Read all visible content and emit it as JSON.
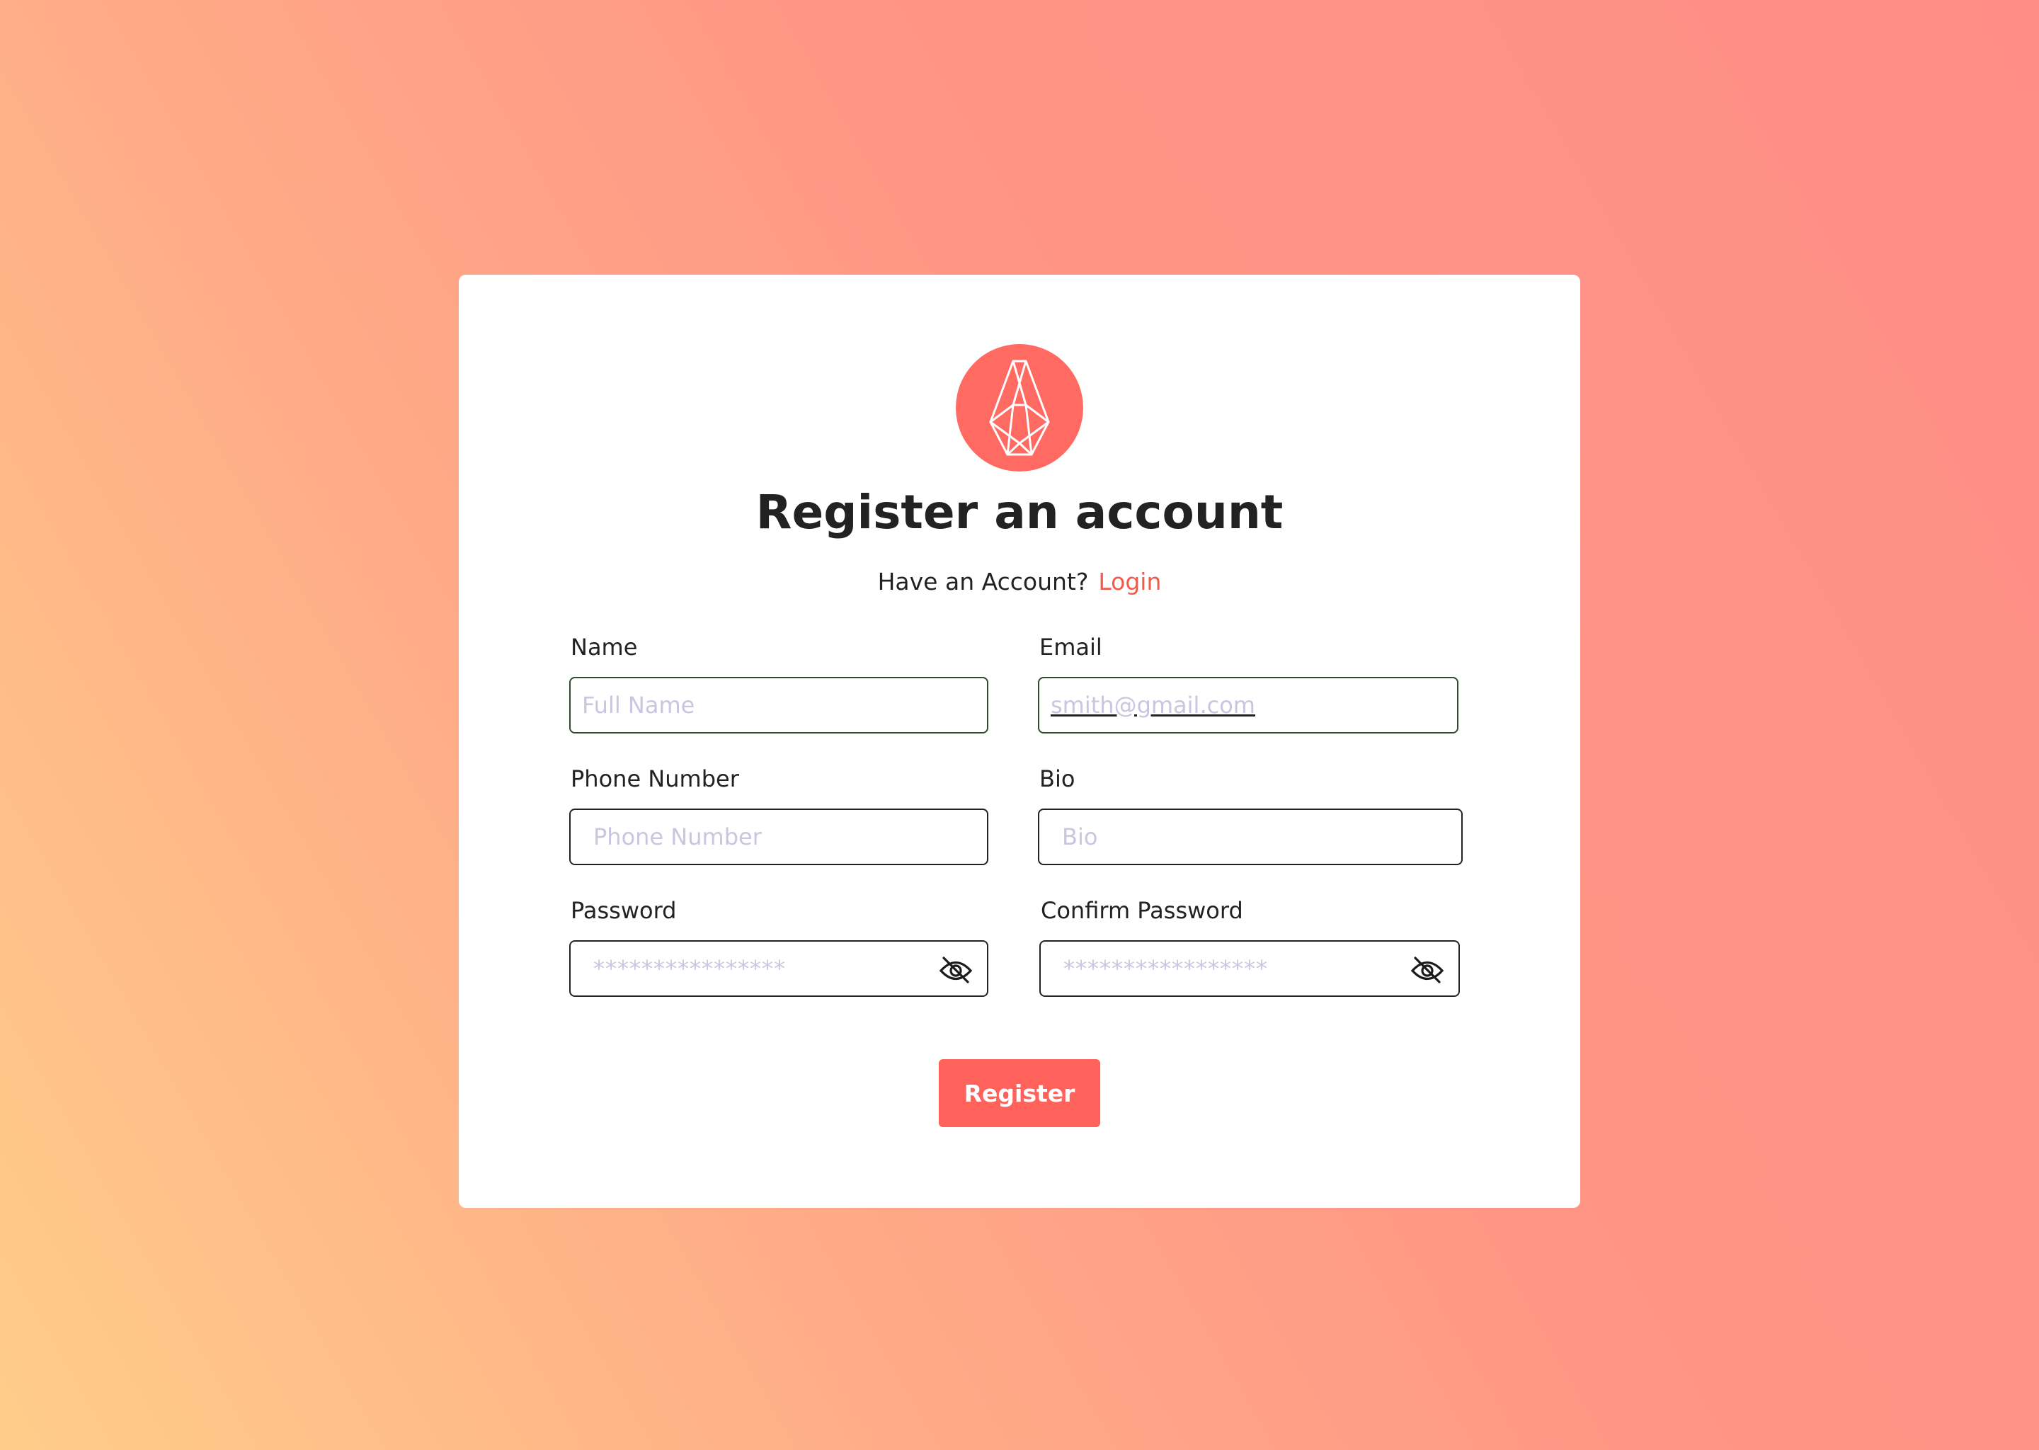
{
  "colors": {
    "accent": "#ff6b62",
    "link": "#f25a4b",
    "placeholder": "#c9c6e0",
    "card": "#ffffff",
    "background_gradient": [
      "#ffcd8a",
      "#ff8d86"
    ]
  },
  "logo": {
    "icon": "crystal-gem-icon"
  },
  "header": {
    "title": "Register an account",
    "prompt": "Have an Account?",
    "login_link": "Login"
  },
  "form": {
    "name": {
      "label": "Name",
      "placeholder": "Full Name",
      "value": ""
    },
    "email": {
      "label": "Email",
      "placeholder": "smith@gmail.com",
      "value": ""
    },
    "phone": {
      "label": "Phone Number",
      "placeholder": "Phone Number",
      "value": ""
    },
    "bio": {
      "label": "Bio",
      "placeholder": "Bio",
      "value": ""
    },
    "password": {
      "label": "Password",
      "placeholder": "****************",
      "value": "",
      "icon": "eye-slash-icon"
    },
    "confirm_password": {
      "label": "Confirm Password",
      "placeholder": "*****************",
      "value": "",
      "icon": "eye-slash-icon"
    },
    "submit_label": "Register"
  }
}
